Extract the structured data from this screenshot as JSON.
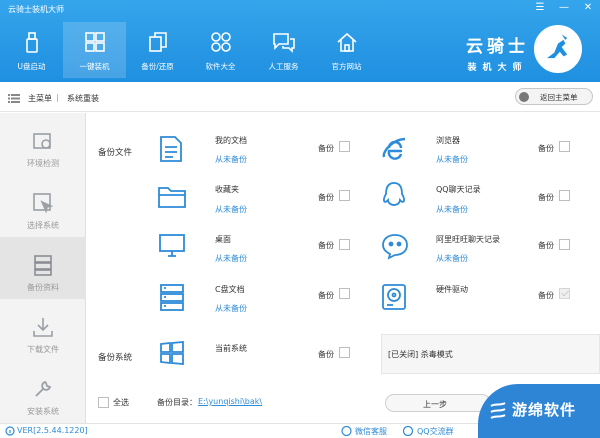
{
  "title": "云骑士装机大师",
  "window_controls": [
    "☰",
    "—",
    "✕"
  ],
  "nav": [
    {
      "label": "U盘启动",
      "icon": "usb-icon"
    },
    {
      "label": "一键装机",
      "icon": "grid-icon",
      "active": true
    },
    {
      "label": "备份/还原",
      "icon": "copy-icon"
    },
    {
      "label": "软件大全",
      "icon": "apps-icon"
    },
    {
      "label": "人工服务",
      "icon": "chat-icon"
    },
    {
      "label": "官方网站",
      "icon": "home-icon"
    }
  ],
  "brand": {
    "line1": "云骑士",
    "line2": "装机大师"
  },
  "breadcrumb": {
    "root": "主菜单",
    "current": "系统重装",
    "sep": "|"
  },
  "back_button": "返回主菜单",
  "sidebar": [
    {
      "label": "环境检测",
      "icon": "check-icon"
    },
    {
      "label": "选择系统",
      "icon": "cursor-icon"
    },
    {
      "label": "备份资料",
      "icon": "database-icon",
      "active": true
    },
    {
      "label": "下载文件",
      "icon": "download-icon"
    },
    {
      "label": "安装系统",
      "icon": "wrench-icon"
    }
  ],
  "section_backup_files": "备份文件",
  "section_backup_system": "备份系统",
  "items_left": [
    {
      "name": "我的文档",
      "status": "从未备份",
      "cb": "备份",
      "icon": "document-icon"
    },
    {
      "name": "收藏夹",
      "status": "从未备份",
      "cb": "备份",
      "icon": "folder-icon"
    },
    {
      "name": "桌面",
      "status": "从未备份",
      "cb": "备份",
      "icon": "monitor-icon"
    },
    {
      "name": "C盘文档",
      "status": "从未备份",
      "cb": "备份",
      "icon": "drive-icon"
    }
  ],
  "items_right": [
    {
      "name": "浏览器",
      "status": "从未备份",
      "cb": "备份",
      "icon": "ie-icon"
    },
    {
      "name": "QQ聊天记录",
      "status": "从未备份",
      "cb": "备份",
      "icon": "qq-icon"
    },
    {
      "name": "阿里旺旺聊天记录",
      "status": "从未备份",
      "cb": "备份",
      "icon": "wangwang-icon"
    },
    {
      "name": "硬件驱动",
      "cb": "备份",
      "icon": "disk-icon"
    }
  ],
  "current_system": {
    "name": "当前系统",
    "cb": "备份",
    "icon": "windows-icon"
  },
  "antivirus": "[已关闭] 杀毒模式",
  "select_all": "全选",
  "backup_dir_label": "备份目录：",
  "backup_dir_path": "E:\\yunqishi\\bak\\",
  "prev_button": "上一步",
  "footer": {
    "version": "VER[2.5.44.1220]",
    "wechat": "微信客服",
    "qq": "QQ交流群"
  },
  "watermark": "游绵软件"
}
